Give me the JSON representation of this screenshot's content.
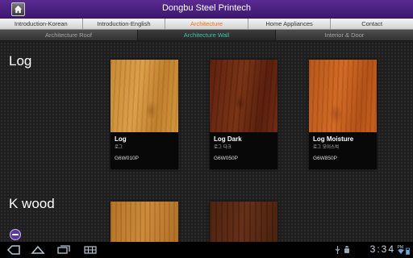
{
  "app": {
    "title": "Dongbu Steel Printech"
  },
  "menu_primary": [
    {
      "label": "Introduction-Korean",
      "active": false
    },
    {
      "label": "Introduction-English",
      "active": false
    },
    {
      "label": "Architecture",
      "active": true
    },
    {
      "label": "Home Appliances",
      "active": false
    },
    {
      "label": "Contact",
      "active": false
    }
  ],
  "menu_secondary": [
    {
      "label": "Architecture Roof",
      "active": false
    },
    {
      "label": "Architecture Wall",
      "active": true
    },
    {
      "label": "Interior & Door",
      "active": false
    }
  ],
  "sections": [
    {
      "title": "Log",
      "products": [
        {
          "name": "Log",
          "name_ko": "로그",
          "code": "G6W010P"
        },
        {
          "name": "Log Dark",
          "name_ko": "로그 다크",
          "code": "G6W050P"
        },
        {
          "name": "Log Moisture",
          "name_ko": "로그 모이스쳐",
          "code": "G6W850P"
        }
      ]
    },
    {
      "title": "K wood",
      "products": [
        {
          "name": "",
          "name_ko": "",
          "code": ""
        },
        {
          "name": "",
          "name_ko": "",
          "code": ""
        }
      ]
    }
  ],
  "status_bar": {
    "time": "3:34",
    "ampm": "PM"
  },
  "colors": {
    "titlebar": "#4a1f7e",
    "accent_orange": "#e8731a",
    "accent_teal": "#3fc1a5"
  },
  "icons": [
    "home-icon",
    "back-icon",
    "home-nav-icon",
    "recent-apps-icon",
    "menu-icon",
    "usb-icon",
    "android-debug-icon",
    "wifi-icon",
    "battery-icon",
    "fab-icon"
  ]
}
